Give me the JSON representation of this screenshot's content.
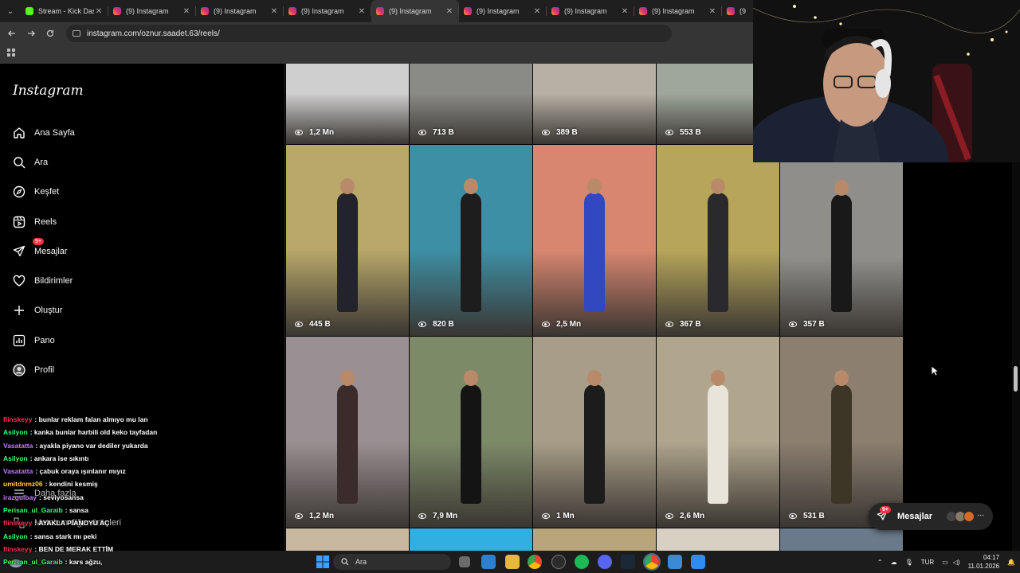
{
  "browser": {
    "tabs": [
      {
        "title": "Stream - Kick Das",
        "favicon": "kick-icon",
        "active": false
      },
      {
        "title": "(9) Instagram",
        "favicon": "instagram-icon",
        "active": false
      },
      {
        "title": "(9) Instagram",
        "favicon": "instagram-icon",
        "active": false
      },
      {
        "title": "(9) Instagram",
        "favicon": "instagram-icon",
        "active": false
      },
      {
        "title": "(9) Instagram",
        "favicon": "instagram-icon",
        "active": true
      },
      {
        "title": "(9) Instagram",
        "favicon": "instagram-icon",
        "active": false
      },
      {
        "title": "(9) Instagram",
        "favicon": "instagram-icon",
        "active": false
      },
      {
        "title": "(9) Instagram",
        "favicon": "instagram-icon",
        "active": false
      },
      {
        "title": "(9",
        "favicon": "instagram-icon",
        "active": false
      }
    ],
    "url": "instagram.com/oznur.saadet.63/reels/"
  },
  "sidebar": {
    "logo": "Instagram",
    "items": [
      {
        "label": "Ana Sayfa",
        "icon": "home-icon"
      },
      {
        "label": "Ara",
        "icon": "search-icon"
      },
      {
        "label": "Keşfet",
        "icon": "compass-icon"
      },
      {
        "label": "Reels",
        "icon": "reels-icon"
      },
      {
        "label": "Mesajlar",
        "icon": "messenger-icon",
        "badge": "9+"
      },
      {
        "label": "Bildirimler",
        "icon": "heart-icon"
      },
      {
        "label": "Oluştur",
        "icon": "plus-icon"
      },
      {
        "label": "Pano",
        "icon": "dashboard-icon"
      },
      {
        "label": "Profil",
        "icon": "profile-icon"
      }
    ],
    "more_label": "Daha fazla",
    "meta_label": "Meta'nın diğer ürünleri"
  },
  "chat": [
    {
      "user": "flinskeyy",
      "msg": ": bunlar reklam falan almıyo mu lan",
      "color": "#ff2d55"
    },
    {
      "user": "Asilyon",
      "msg": ": kanka bunlar harbili old keko tayfadan",
      "color": "#3cff6a"
    },
    {
      "user": "Vasatatta",
      "msg": ": ayakla piyano var dediler yukarda",
      "color": "#c07bff"
    },
    {
      "user": "Asilyon",
      "msg": ": ankara ise sıkıntı",
      "color": "#3cff6a"
    },
    {
      "user": "Vasatatta",
      "msg": ": çabuk oraya ışınlanır mıyız",
      "color": "#c07bff"
    },
    {
      "user": "umitdnmz06",
      "msg": ": kendini kesmiş",
      "color": "#ffd23c"
    },
    {
      "user": "irazgulbay",
      "msg": ": seviyosansa",
      "color": "#c07bff"
    },
    {
      "user": "Perisan_ul_Garaib",
      "msg": ": sansa",
      "color": "#3cff6a"
    },
    {
      "user": "flinskeyy",
      "msg": ": AYAKLA PİANOYU AÇ",
      "color": "#ff2d55"
    },
    {
      "user": "Asilyon",
      "msg": ": sansa stark mı peki",
      "color": "#3cff6a"
    },
    {
      "user": "flinskeyy",
      "msg": ": BEN DE MERAK ETTİM",
      "color": "#ff2d55"
    },
    {
      "user": "Perisan_ul_Garaib",
      "msg": ": kars ağzu,",
      "color": "#3cff6a"
    }
  ],
  "reels": [
    {
      "views": "1,2 Mn",
      "bg": "#cfcfcf",
      "fig": "#5a6b88"
    },
    {
      "views": "713 B",
      "bg": "#8a8a86",
      "fig": "#151515"
    },
    {
      "views": "389 B",
      "bg": "#b7b1a5",
      "fig": "#6f93c0"
    },
    {
      "views": "553 B",
      "bg": "#9fa79c",
      "fig": "#b49aa8"
    },
    {
      "views": "445 B",
      "bg": "#b9a86a",
      "fig": "#23232b"
    },
    {
      "views": "820 B",
      "bg": "#3d8fa5",
      "fig": "#1d1d1d"
    },
    {
      "views": "2,5 Mn",
      "bg": "#d98670",
      "fig": "#3148c0"
    },
    {
      "views": "367 B",
      "bg": "#b7a65a",
      "fig": "#2a2a2e"
    },
    {
      "views": "357 B",
      "bg": "#8f8e8a",
      "fig": "#191919"
    },
    {
      "views": "1,2 Mn",
      "bg": "#9a8f92",
      "fig": "#3b2b2a"
    },
    {
      "views": "7,9 Mn",
      "bg": "#7d8a68",
      "fig": "#141414"
    },
    {
      "views": "1 Mn",
      "bg": "#a89d88",
      "fig": "#1c1c1c"
    },
    {
      "views": "2,6 Mn",
      "bg": "#b0a58d",
      "fig": "#e8e4da"
    },
    {
      "views": "531 B",
      "bg": "#8c7f70",
      "fig": "#3d3626"
    }
  ],
  "messages_bar": {
    "label": "Mesajlar",
    "badge": "9+"
  },
  "taskbar": {
    "search_label": "Ara",
    "lang": "TUR",
    "time": "04:17",
    "date": "11.01.2026"
  }
}
